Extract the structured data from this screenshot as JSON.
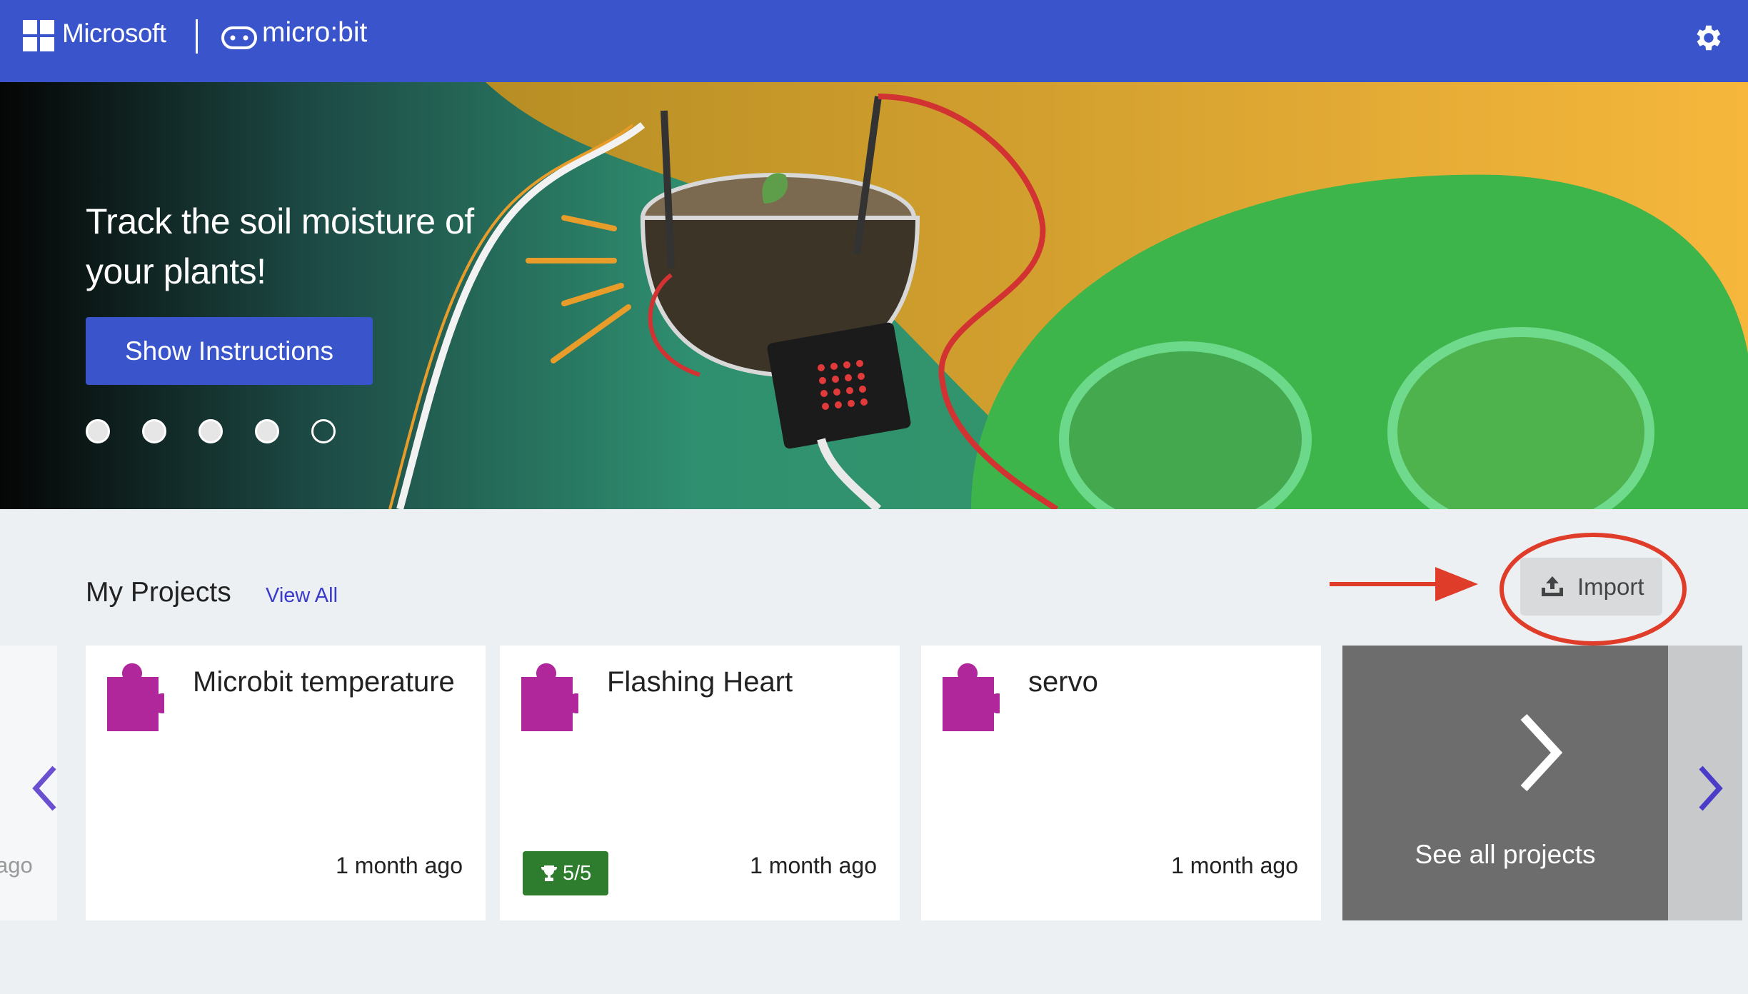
{
  "header": {
    "brand": "Microsoft",
    "product": "micro:bit",
    "settings_icon": "gear-icon"
  },
  "hero": {
    "title": "Track the soil moisture of your plants!",
    "button_label": "Show Instructions",
    "dots": [
      {
        "active": false
      },
      {
        "active": false
      },
      {
        "active": false
      },
      {
        "active": false
      },
      {
        "active": true
      }
    ]
  },
  "projects": {
    "title": "My Projects",
    "view_all": "View All",
    "import_label": "Import",
    "partial_card_time": "ago",
    "cards": [
      {
        "name": "Microbit temperature",
        "time": "1 month ago",
        "icon": "puzzle-icon"
      },
      {
        "name": "Flashing Heart",
        "time": "1 month ago",
        "badge": "5/5",
        "icon": "puzzle-icon"
      },
      {
        "name": "servo",
        "time": "1 month ago",
        "icon": "puzzle-icon"
      }
    ],
    "see_all": "See all projects"
  },
  "colors": {
    "header": "#3a55cc",
    "button": "#3a55cc",
    "puzzle": "#b0279b",
    "badge": "#2e7d2e",
    "annotation": "#e03c2a"
  }
}
